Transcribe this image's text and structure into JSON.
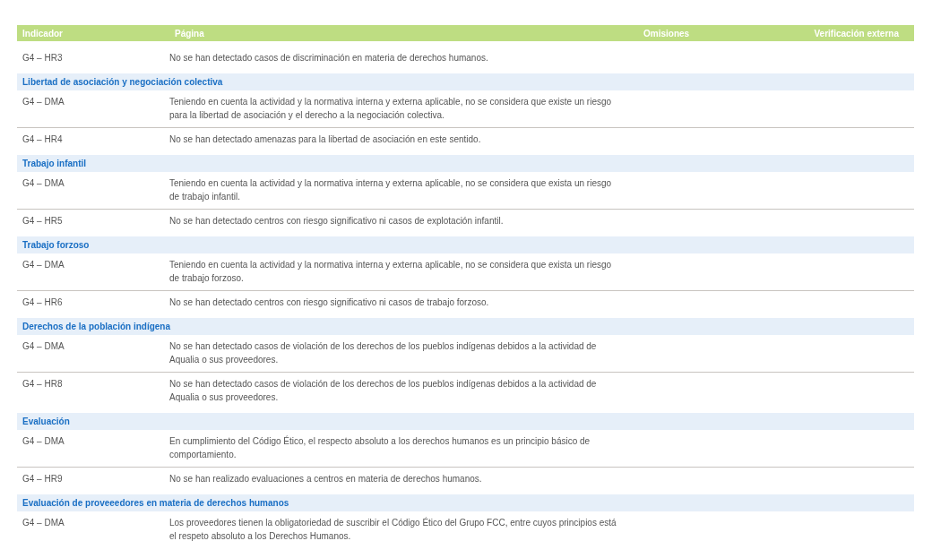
{
  "table": {
    "columns": [
      "Indicador",
      "Página",
      "Omisiones",
      "Verificación externa"
    ],
    "rows": [
      {
        "kind": "row",
        "indicator": "G4 – HR3",
        "text": [
          "No se han detectado casos de discriminación en materia de derechos humanos."
        ]
      },
      {
        "kind": "section",
        "title": "Libertad de asociación y negociación colectiva"
      },
      {
        "kind": "row",
        "indicator": "G4 – DMA",
        "text": [
          "Teniendo en cuenta la actividad y la normativa interna y externa aplicable, no se considera que existe un riesgo",
          "para la libertad de asociación y el derecho a la negociación colectiva."
        ]
      },
      {
        "kind": "row",
        "indicator": "G4 – HR4",
        "text": [
          "No se han detectado amenazas para la libertad de asociación en este sentido."
        ]
      },
      {
        "kind": "section",
        "title": "Trabajo infantil"
      },
      {
        "kind": "row",
        "indicator": "G4 – DMA",
        "text": [
          "Teniendo en cuenta la actividad y la normativa interna y externa aplicable, no se considera que exista un riesgo",
          "de trabajo infantil."
        ]
      },
      {
        "kind": "row",
        "indicator": "G4 – HR5",
        "text": [
          "No se han detectado centros con riesgo significativo ni casos de explotación infantil."
        ]
      },
      {
        "kind": "section",
        "title": "Trabajo forzoso"
      },
      {
        "kind": "row",
        "indicator": "G4 – DMA",
        "text": [
          "Teniendo en cuenta la actividad y la normativa interna y externa aplicable, no se considera que exista un riesgo",
          "de trabajo forzoso."
        ]
      },
      {
        "kind": "row",
        "indicator": "G4 – HR6",
        "text": [
          "No se han detectado centros con riesgo significativo ni casos de trabajo forzoso."
        ]
      },
      {
        "kind": "section",
        "title": "Derechos de la población indígena"
      },
      {
        "kind": "row",
        "indicator": "G4 – DMA",
        "text": [
          "No se han detectado casos de violación de los derechos de los pueblos indígenas debidos a la actividad de",
          "Aqualia o sus proveedores."
        ]
      },
      {
        "kind": "row",
        "indicator": "G4 – HR8",
        "text": [
          "No se han detectado casos de violación de los derechos de los pueblos indígenas debidos a la actividad de",
          "Aqualia o sus proveedores."
        ]
      },
      {
        "kind": "section",
        "title": "Evaluación"
      },
      {
        "kind": "row",
        "indicator": "G4 – DMA",
        "text": [
          "En cumplimiento del Código Ético, el respecto absoluto a los derechos humanos es un principio básico de",
          "comportamiento."
        ]
      },
      {
        "kind": "row",
        "indicator": "G4 – HR9",
        "text": [
          "No se han realizado evaluaciones a centros en materia de derechos humanos."
        ]
      },
      {
        "kind": "section",
        "title": "Evaluación de proveeedores en materia de derechos humanos"
      },
      {
        "kind": "row",
        "indicator": "G4 – DMA",
        "text": [
          "Los proveedores tienen la obligatoriedad de suscribir el Código Ético del Grupo FCC, entre cuyos principios está",
          "el respeto absoluto a los Derechos Humanos."
        ]
      }
    ]
  }
}
